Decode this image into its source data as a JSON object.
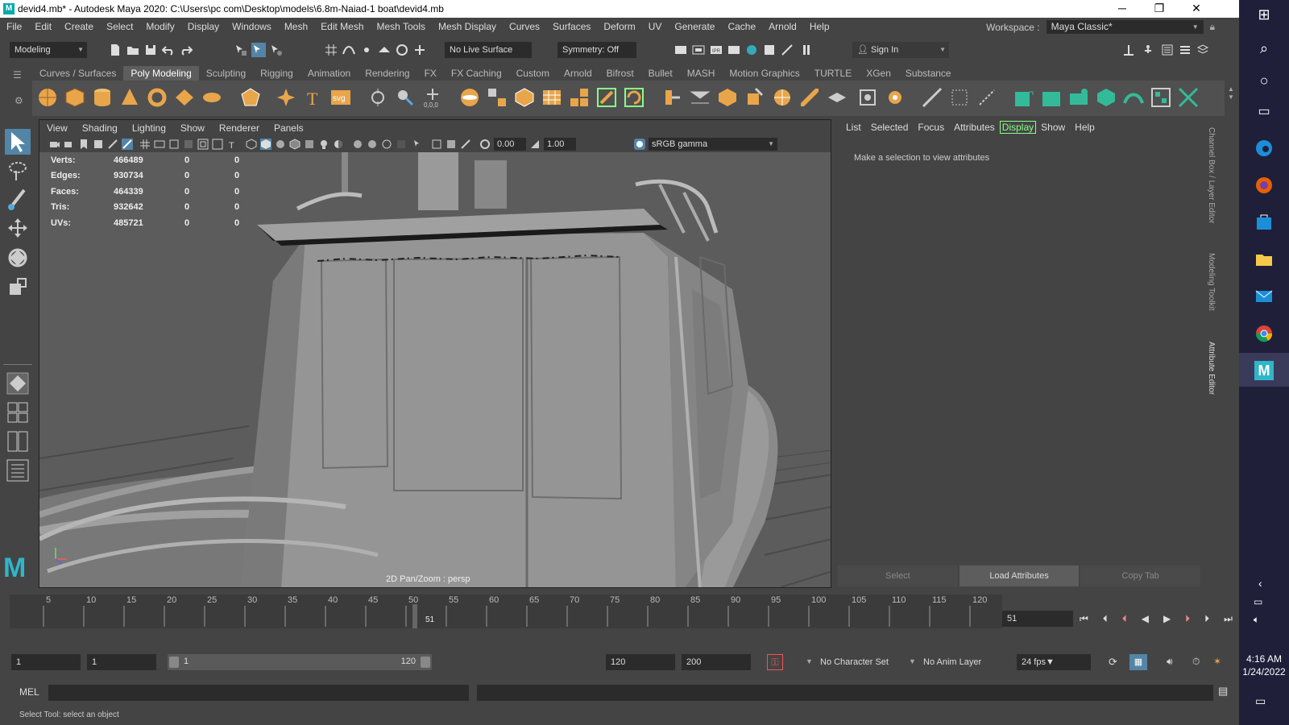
{
  "window": {
    "title": "devid4.mb* - Autodesk Maya 2020: C:\\Users\\pc com\\Desktop\\models\\6.8m-Naiad-1 boat\\devid4.mb"
  },
  "menubar": {
    "items": [
      "File",
      "Edit",
      "Create",
      "Select",
      "Modify",
      "Display",
      "Windows",
      "Mesh",
      "Edit Mesh",
      "Mesh Tools",
      "Mesh Display",
      "Curves",
      "Surfaces",
      "Deform",
      "UV",
      "Generate",
      "Cache",
      "Arnold",
      "Help"
    ],
    "workspace_label": "Workspace :",
    "workspace_value": "Maya Classic*"
  },
  "statusline": {
    "menuset": "Modeling",
    "live_surface": "No Live Surface",
    "symmetry": "Symmetry: Off",
    "sign_in": "Sign In"
  },
  "shelf": {
    "tabs": [
      "Curves / Surfaces",
      "Poly Modeling",
      "Sculpting",
      "Rigging",
      "Animation",
      "Rendering",
      "FX",
      "FX Caching",
      "Custom",
      "Arnold",
      "Bifrost",
      "Bullet",
      "MASH",
      "Motion Graphics",
      "TURTLE",
      "XGen",
      "Substance"
    ],
    "active_tab": "Poly Modeling"
  },
  "viewport": {
    "menu": [
      "View",
      "Shading",
      "Lighting",
      "Show",
      "Renderer",
      "Panels"
    ],
    "exposure": "0.00",
    "gamma": "1.00",
    "color_space": "sRGB gamma",
    "hud": [
      {
        "label": "Verts:",
        "total": "466489",
        "sel": "0",
        "tris": "0"
      },
      {
        "label": "Edges:",
        "total": "930734",
        "sel": "0",
        "tris": "0"
      },
      {
        "label": "Faces:",
        "total": "464339",
        "sel": "0",
        "tris": "0"
      },
      {
        "label": "Tris:",
        "total": "932642",
        "sel": "0",
        "tris": "0"
      },
      {
        "label": "UVs:",
        "total": "485721",
        "sel": "0",
        "tris": "0"
      }
    ],
    "camera_label": "2D Pan/Zoom : persp"
  },
  "attribute_editor": {
    "menu": [
      "List",
      "Selected",
      "Focus",
      "Attributes",
      "Display",
      "Show",
      "Help"
    ],
    "active_menu": "Display",
    "message": "Make a selection to view attributes",
    "buttons": [
      "Select",
      "Load Attributes",
      "Copy Tab"
    ],
    "side_tabs": [
      "Channel Box / Layer Editor",
      "Modeling Toolkit",
      "Attribute Editor"
    ]
  },
  "timeline": {
    "ticks": [
      "5",
      "10",
      "15",
      "20",
      "25",
      "30",
      "35",
      "40",
      "45",
      "50",
      "55",
      "60",
      "65",
      "70",
      "75",
      "80",
      "85",
      "90",
      "95",
      "100",
      "105",
      "110",
      "115",
      "120"
    ],
    "current_frame": "51",
    "current_frame_field": "51"
  },
  "range": {
    "start": "1",
    "anim_start": "1",
    "slider_start": "1",
    "slider_end": "120",
    "end": "120",
    "anim_end": "200",
    "character_set": "No Character Set",
    "anim_layer": "No Anim Layer",
    "fps": "24 fps"
  },
  "command_line": {
    "label": "MEL"
  },
  "help_line": "Select Tool: select an object",
  "taskbar": {
    "time": "4:16 AM",
    "date": "1/24/2022"
  },
  "colors": {
    "bg": "#444444",
    "field": "#2b2b2b",
    "viewport": "#5a5a5a",
    "active_green": "#88ff88",
    "taskbar": "#1f1f3a"
  }
}
